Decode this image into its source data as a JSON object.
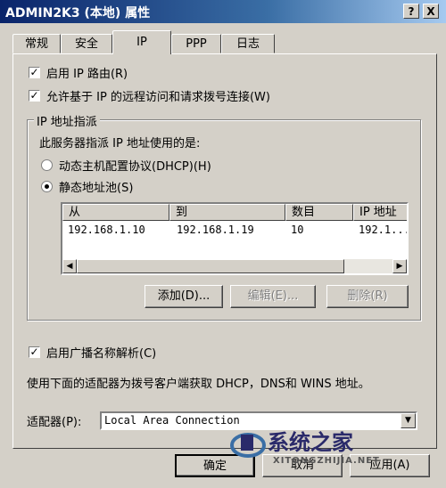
{
  "window": {
    "title": "ADMIN2K3 (本地) 属性",
    "help_btn": "?",
    "close_btn": "X"
  },
  "tabs": [
    {
      "label": "常规"
    },
    {
      "label": "安全"
    },
    {
      "label": "IP"
    },
    {
      "label": "PPP"
    },
    {
      "label": "日志"
    }
  ],
  "active_tab": "IP",
  "options": {
    "enable_ip_routing": {
      "label": "启用 IP 路由(R)",
      "checked": true
    },
    "allow_remote": {
      "label": "允许基于 IP 的远程访问和请求拨号连接(W)",
      "checked": true
    }
  },
  "ip_assignment": {
    "group_title": "IP 地址指派",
    "description": "此服务器指派 IP 地址使用的是:",
    "dhcp": {
      "label": "动态主机配置协议(DHCP)(H)",
      "selected": false
    },
    "static_pool": {
      "label": "静态地址池(S)",
      "selected": true
    },
    "columns": {
      "from": "从",
      "to": "到",
      "count": "数目",
      "ip": "IP 地址"
    },
    "rows": [
      {
        "from": "192.168.1.10",
        "to": "192.168.1.19",
        "count": "10",
        "ip": "192.1..."
      }
    ],
    "add_btn": "添加(D)...",
    "edit_btn": "编辑(E)...",
    "delete_btn": "删除(R)"
  },
  "broadcast": {
    "label": "启用广播名称解析(C)",
    "checked": true
  },
  "adapter_desc": "使用下面的适配器为拨号客户端获取 DHCP，DNS和 WINS 地址。",
  "adapter": {
    "label": "适配器(P):",
    "value": "Local Area Connection"
  },
  "footer": {
    "ok": "确定",
    "cancel": "取消",
    "apply": "应用(A)"
  },
  "watermark": {
    "text": "系统之家",
    "sub": "XITONGZHIJIA.NET"
  }
}
